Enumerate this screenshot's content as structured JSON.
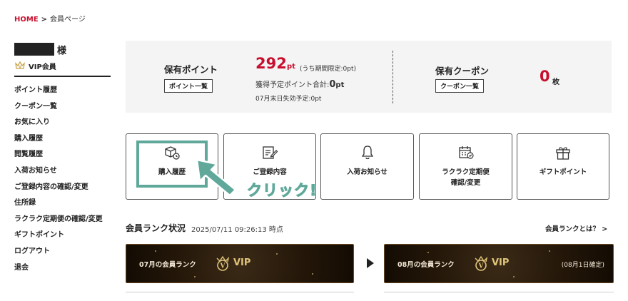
{
  "breadcrumb": {
    "home": "HOME",
    "separator": ">",
    "current": "会員ページ"
  },
  "user": {
    "honorific": "様",
    "rank_label": "VIP会員"
  },
  "sidebar": {
    "items": [
      {
        "label": "ポイント履歴"
      },
      {
        "label": "クーポン一覧"
      },
      {
        "label": "お気に入り"
      },
      {
        "label": "購入履歴"
      },
      {
        "label": "閲覧履歴"
      },
      {
        "label": "入荷お知らせ"
      },
      {
        "label": "ご登録内容の確認/変更"
      },
      {
        "label": "住所録"
      },
      {
        "label": "ラクラク定期便の確認/変更"
      },
      {
        "label": "ギフトポイント"
      },
      {
        "label": "ログアウト"
      },
      {
        "label": "退会"
      }
    ]
  },
  "points": {
    "label": "保有ポイント",
    "button": "ポイント一覧",
    "value": "292",
    "unit": "pt",
    "limited_note": "(うち期間限定:0pt)",
    "scheduled_prefix": "獲得予定ポイント合計:",
    "scheduled_value": "0",
    "scheduled_unit": "pt",
    "expiring": "07月末日失効予定:0pt"
  },
  "coupons": {
    "label": "保有クーポン",
    "button": "クーポン一覧",
    "value": "0",
    "unit": "枚"
  },
  "tiles": [
    {
      "label": "購入履歴",
      "icon": "box-clock-icon"
    },
    {
      "label": "ご登録内容",
      "icon": "edit-document-icon"
    },
    {
      "label": "入荷お知らせ",
      "icon": "bell-icon"
    },
    {
      "label": "ラクラク定期便",
      "label2": "確認/変更",
      "icon": "calendar-check-icon"
    },
    {
      "label": "ギフトポイント",
      "icon": "gift-icon"
    }
  ],
  "annotation": {
    "click_text": "クリック!",
    "color": "#5fa89a"
  },
  "rank": {
    "title": "会員ランク状況",
    "timestamp": "2025/07/11 09:26:13 時点",
    "link": "会員ランクとは？ >",
    "current": {
      "month_label": "07月の会員ランク",
      "rank": "VIP"
    },
    "next": {
      "month_label": "08月の会員ランク",
      "rank": "VIP",
      "note": "(08月1日確定)"
    }
  },
  "colors": {
    "accent_red": "#c8102e",
    "gold": "#e0c57a",
    "teal": "#5fa89a"
  }
}
